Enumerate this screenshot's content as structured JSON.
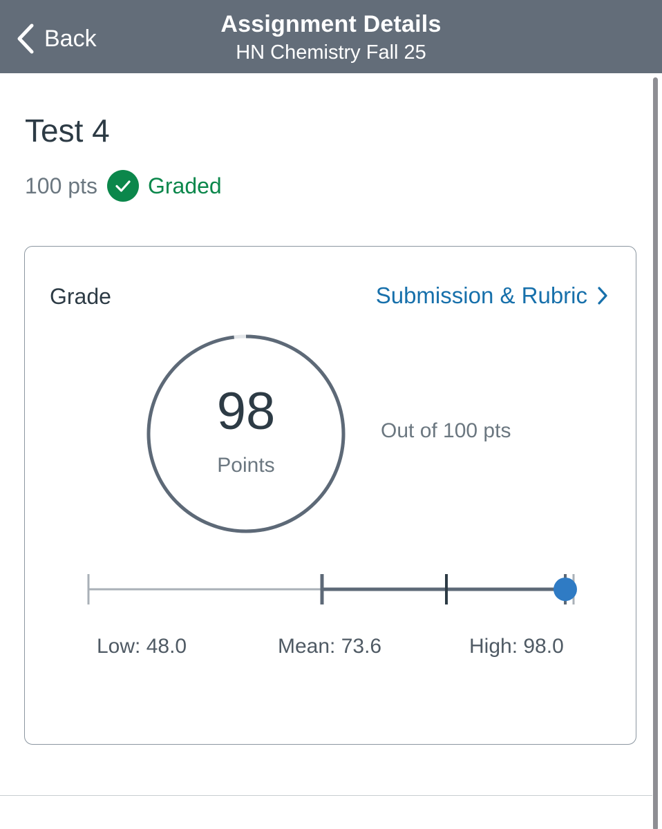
{
  "navbar": {
    "back_label": "Back",
    "title": "Assignment Details",
    "subtitle": "HN Chemistry Fall 25",
    "background_color": "#636d79",
    "back_icon": "chevron-left-icon"
  },
  "assignment": {
    "title": "Test 4",
    "points_possible": "100 pts",
    "status": "Graded",
    "status_icon": "check-circle-icon",
    "status_color": "#0b874b"
  },
  "grade_card": {
    "heading": "Grade",
    "link_label": "Submission & Rubric",
    "link_color": "#1770ab",
    "link_icon": "chevron-right-icon",
    "score": "98",
    "score_unit": "Points",
    "out_of": "Out of 100 pts",
    "score_fraction": 0.98,
    "stats": {
      "low_label": "Low: 48.0",
      "mean_label": "Mean: 73.6",
      "high_label": "High: 98.0",
      "range_min": 0,
      "range_max": 100,
      "low": 48.0,
      "mean": 73.6,
      "high": 98.0,
      "score": 98,
      "marker_color": "#2f7bc4"
    }
  }
}
